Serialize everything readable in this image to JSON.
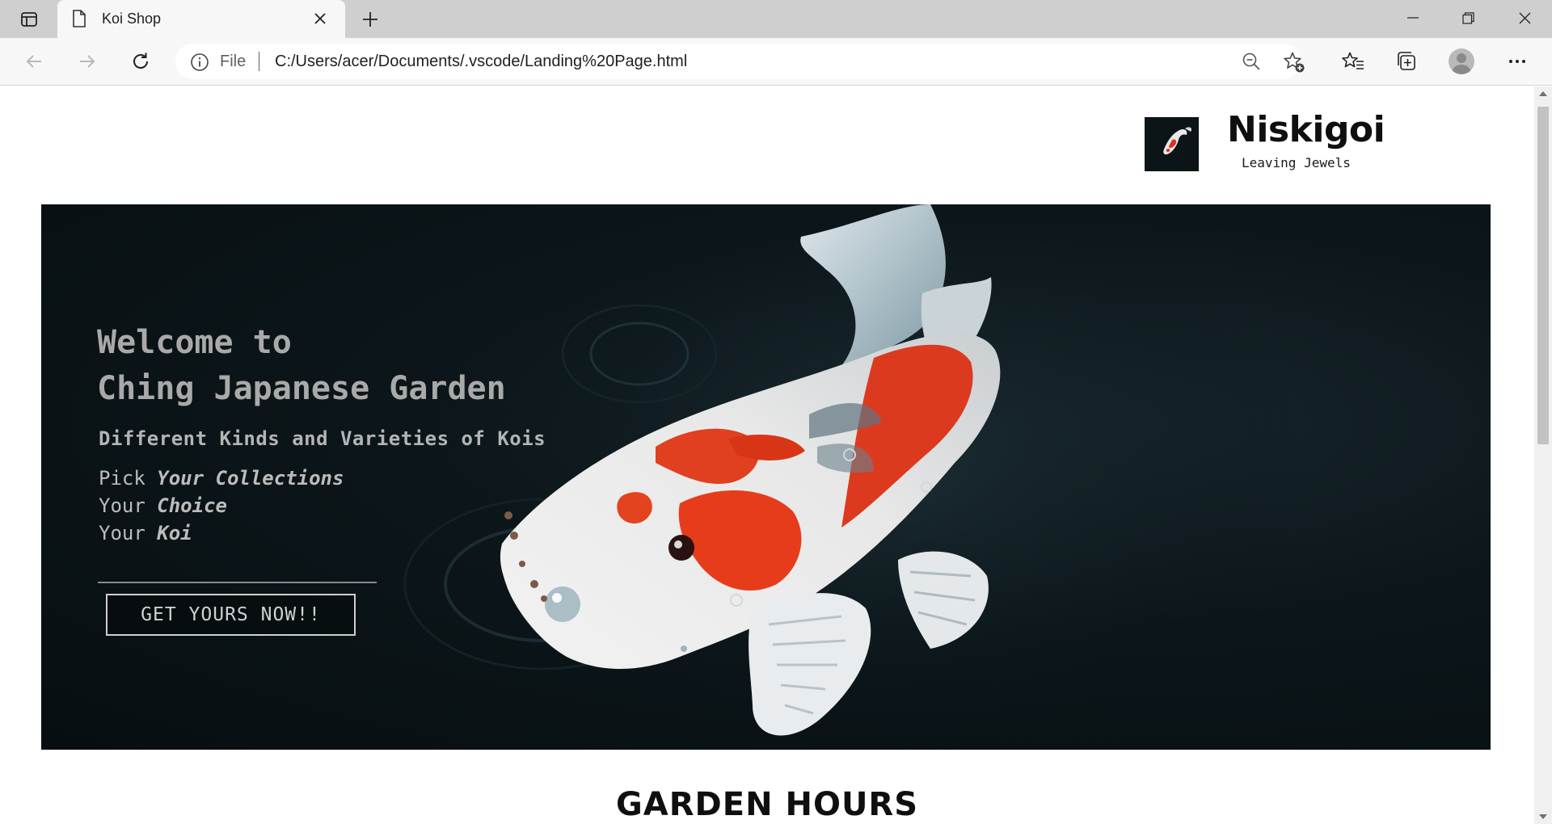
{
  "browser": {
    "tab_title": "Koi Shop",
    "address_scheme": "File",
    "address_url": "C:/Users/acer/Documents/.vscode/Landing%20Page.html"
  },
  "brand": {
    "name": "Niskigoi",
    "tagline": "Leaving Jewels"
  },
  "hero": {
    "title_line1": "Welcome to",
    "title_line2": "Ching Japanese Garden",
    "subtitle": "Different Kinds and Varieties of Kois",
    "lines": [
      {
        "prefix": "Pick",
        "emphasis": "Your Collections"
      },
      {
        "prefix": "Your",
        "emphasis": "Choice"
      },
      {
        "prefix": "Your",
        "emphasis": "Koi"
      }
    ],
    "cta_label": "GET YOURS NOW!!"
  },
  "section": {
    "title": "GARDEN HOURS"
  },
  "colors": {
    "hero_background": "#0c161a",
    "hero_text": "#a9a9a9",
    "koi_red": "#e0391c",
    "koi_white": "#eeeeee"
  }
}
